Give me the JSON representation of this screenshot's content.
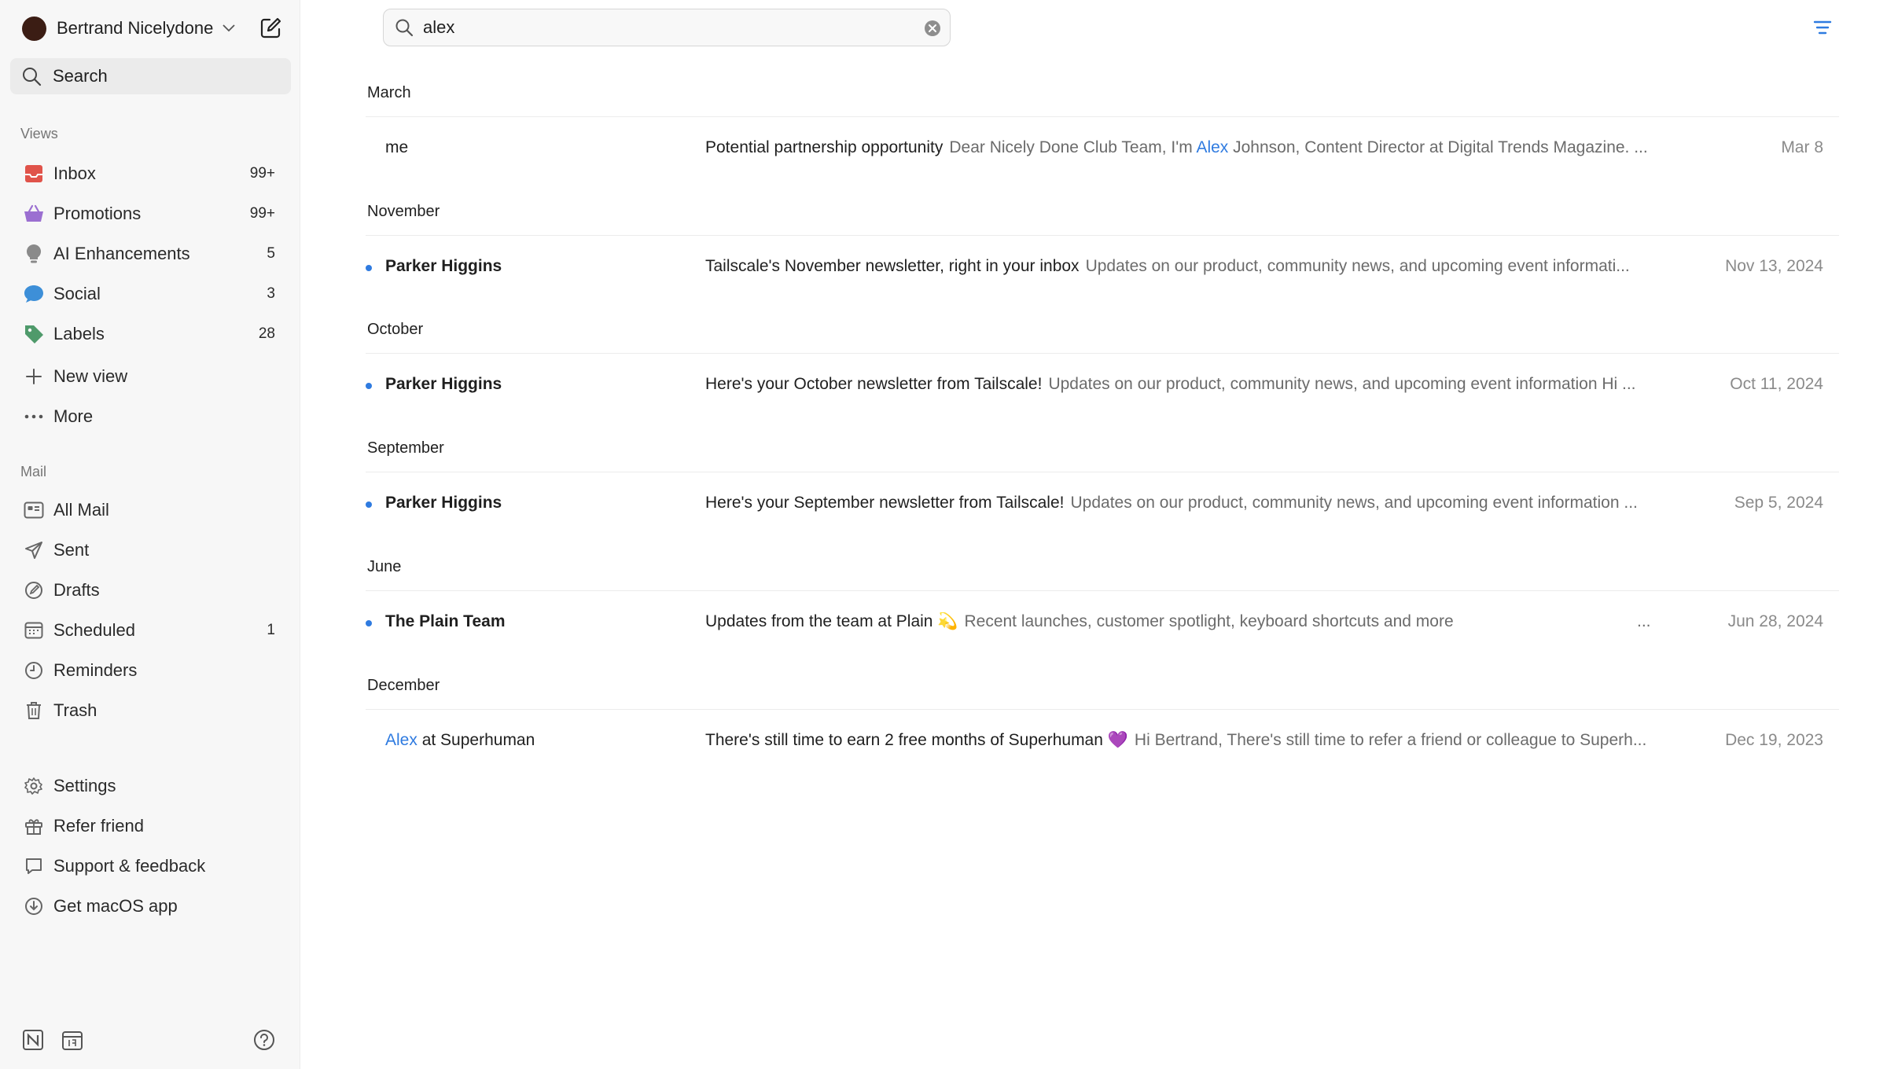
{
  "account": {
    "name": "Bertrand Nicelydone"
  },
  "sidebar": {
    "search_label": "Search",
    "views_title": "Views",
    "views": [
      {
        "label": "Inbox",
        "count": "99+",
        "icon": "inbox-icon",
        "color": "#e0534a"
      },
      {
        "label": "Promotions",
        "count": "99+",
        "icon": "basket-icon",
        "color": "#9b6fd1"
      },
      {
        "label": "AI Enhancements",
        "count": "5",
        "icon": "lightbulb-icon",
        "color": "#8a8a8a"
      },
      {
        "label": "Social",
        "count": "3",
        "icon": "chat-bubble-icon",
        "color": "#3d8fd8"
      },
      {
        "label": "Labels",
        "count": "28",
        "icon": "tag-icon",
        "color": "#4f9a6b"
      }
    ],
    "new_view_label": "New view",
    "more_label": "More",
    "mail_title": "Mail",
    "mail": [
      {
        "label": "All Mail",
        "count": "",
        "icon": "all-mail-icon"
      },
      {
        "label": "Sent",
        "count": "",
        "icon": "send-icon"
      },
      {
        "label": "Drafts",
        "count": "",
        "icon": "drafts-icon"
      },
      {
        "label": "Scheduled",
        "count": "1",
        "icon": "calendar-icon"
      },
      {
        "label": "Reminders",
        "count": "",
        "icon": "clock-icon"
      },
      {
        "label": "Trash",
        "count": "",
        "icon": "trash-icon"
      }
    ],
    "footer": [
      {
        "label": "Settings",
        "icon": "gear-icon"
      },
      {
        "label": "Refer friend",
        "icon": "gift-icon"
      },
      {
        "label": "Support & feedback",
        "icon": "speech-bubble-icon"
      },
      {
        "label": "Get macOS app",
        "icon": "download-icon"
      }
    ]
  },
  "search": {
    "query": "alex"
  },
  "results": {
    "groups": [
      "March",
      "November",
      "October",
      "September",
      "June",
      "December"
    ],
    "rows": [
      {
        "sender": "me",
        "sender_hl": "",
        "sender_rest": "",
        "unread": false,
        "subject": "Potential partnership opportunity",
        "preview_pre": "Dear Nicely Done Club Team, I'm ",
        "preview_hl": "Alex",
        "preview_post": " Johnson, Content Director at Digital Trends Magazine. ...",
        "date": "Mar 8"
      },
      {
        "sender": "Parker Higgins",
        "unread": true,
        "subject": "Tailscale's November newsletter, right in your inbox",
        "preview_pre": "Updates on our product, community news, and upcoming event informati...",
        "date": "Nov 13, 2024"
      },
      {
        "sender": "Parker Higgins",
        "unread": true,
        "subject": "Here's your October newsletter from Tailscale!",
        "preview_pre": "Updates on our product, community news, and upcoming event information Hi ...",
        "date": "Oct 11, 2024"
      },
      {
        "sender": "Parker Higgins",
        "unread": true,
        "subject": "Here's your September newsletter from Tailscale!",
        "preview_pre": "Updates on our product, community news, and upcoming event information ...",
        "date": "Sep 5, 2024"
      },
      {
        "sender": "The Plain Team",
        "unread": true,
        "subject": "Updates from the team at Plain 💫",
        "preview_pre": "Recent launches, customer spotlight, keyboard shortcuts and more",
        "ellipsis": "...",
        "date": "Jun 28, 2024"
      },
      {
        "sender_hl": "Alex",
        "sender_rest": " at Superhuman",
        "unread": false,
        "subject": "There's still time to earn 2 free months of Superhuman 💜",
        "preview_pre": "Hi Bertrand, There's still time to refer a friend or colleague to Superh...",
        "date": "Dec 19, 2023"
      }
    ]
  },
  "colors": {
    "accent": "#2f7be0",
    "unread_dot": "#2f7be0"
  }
}
